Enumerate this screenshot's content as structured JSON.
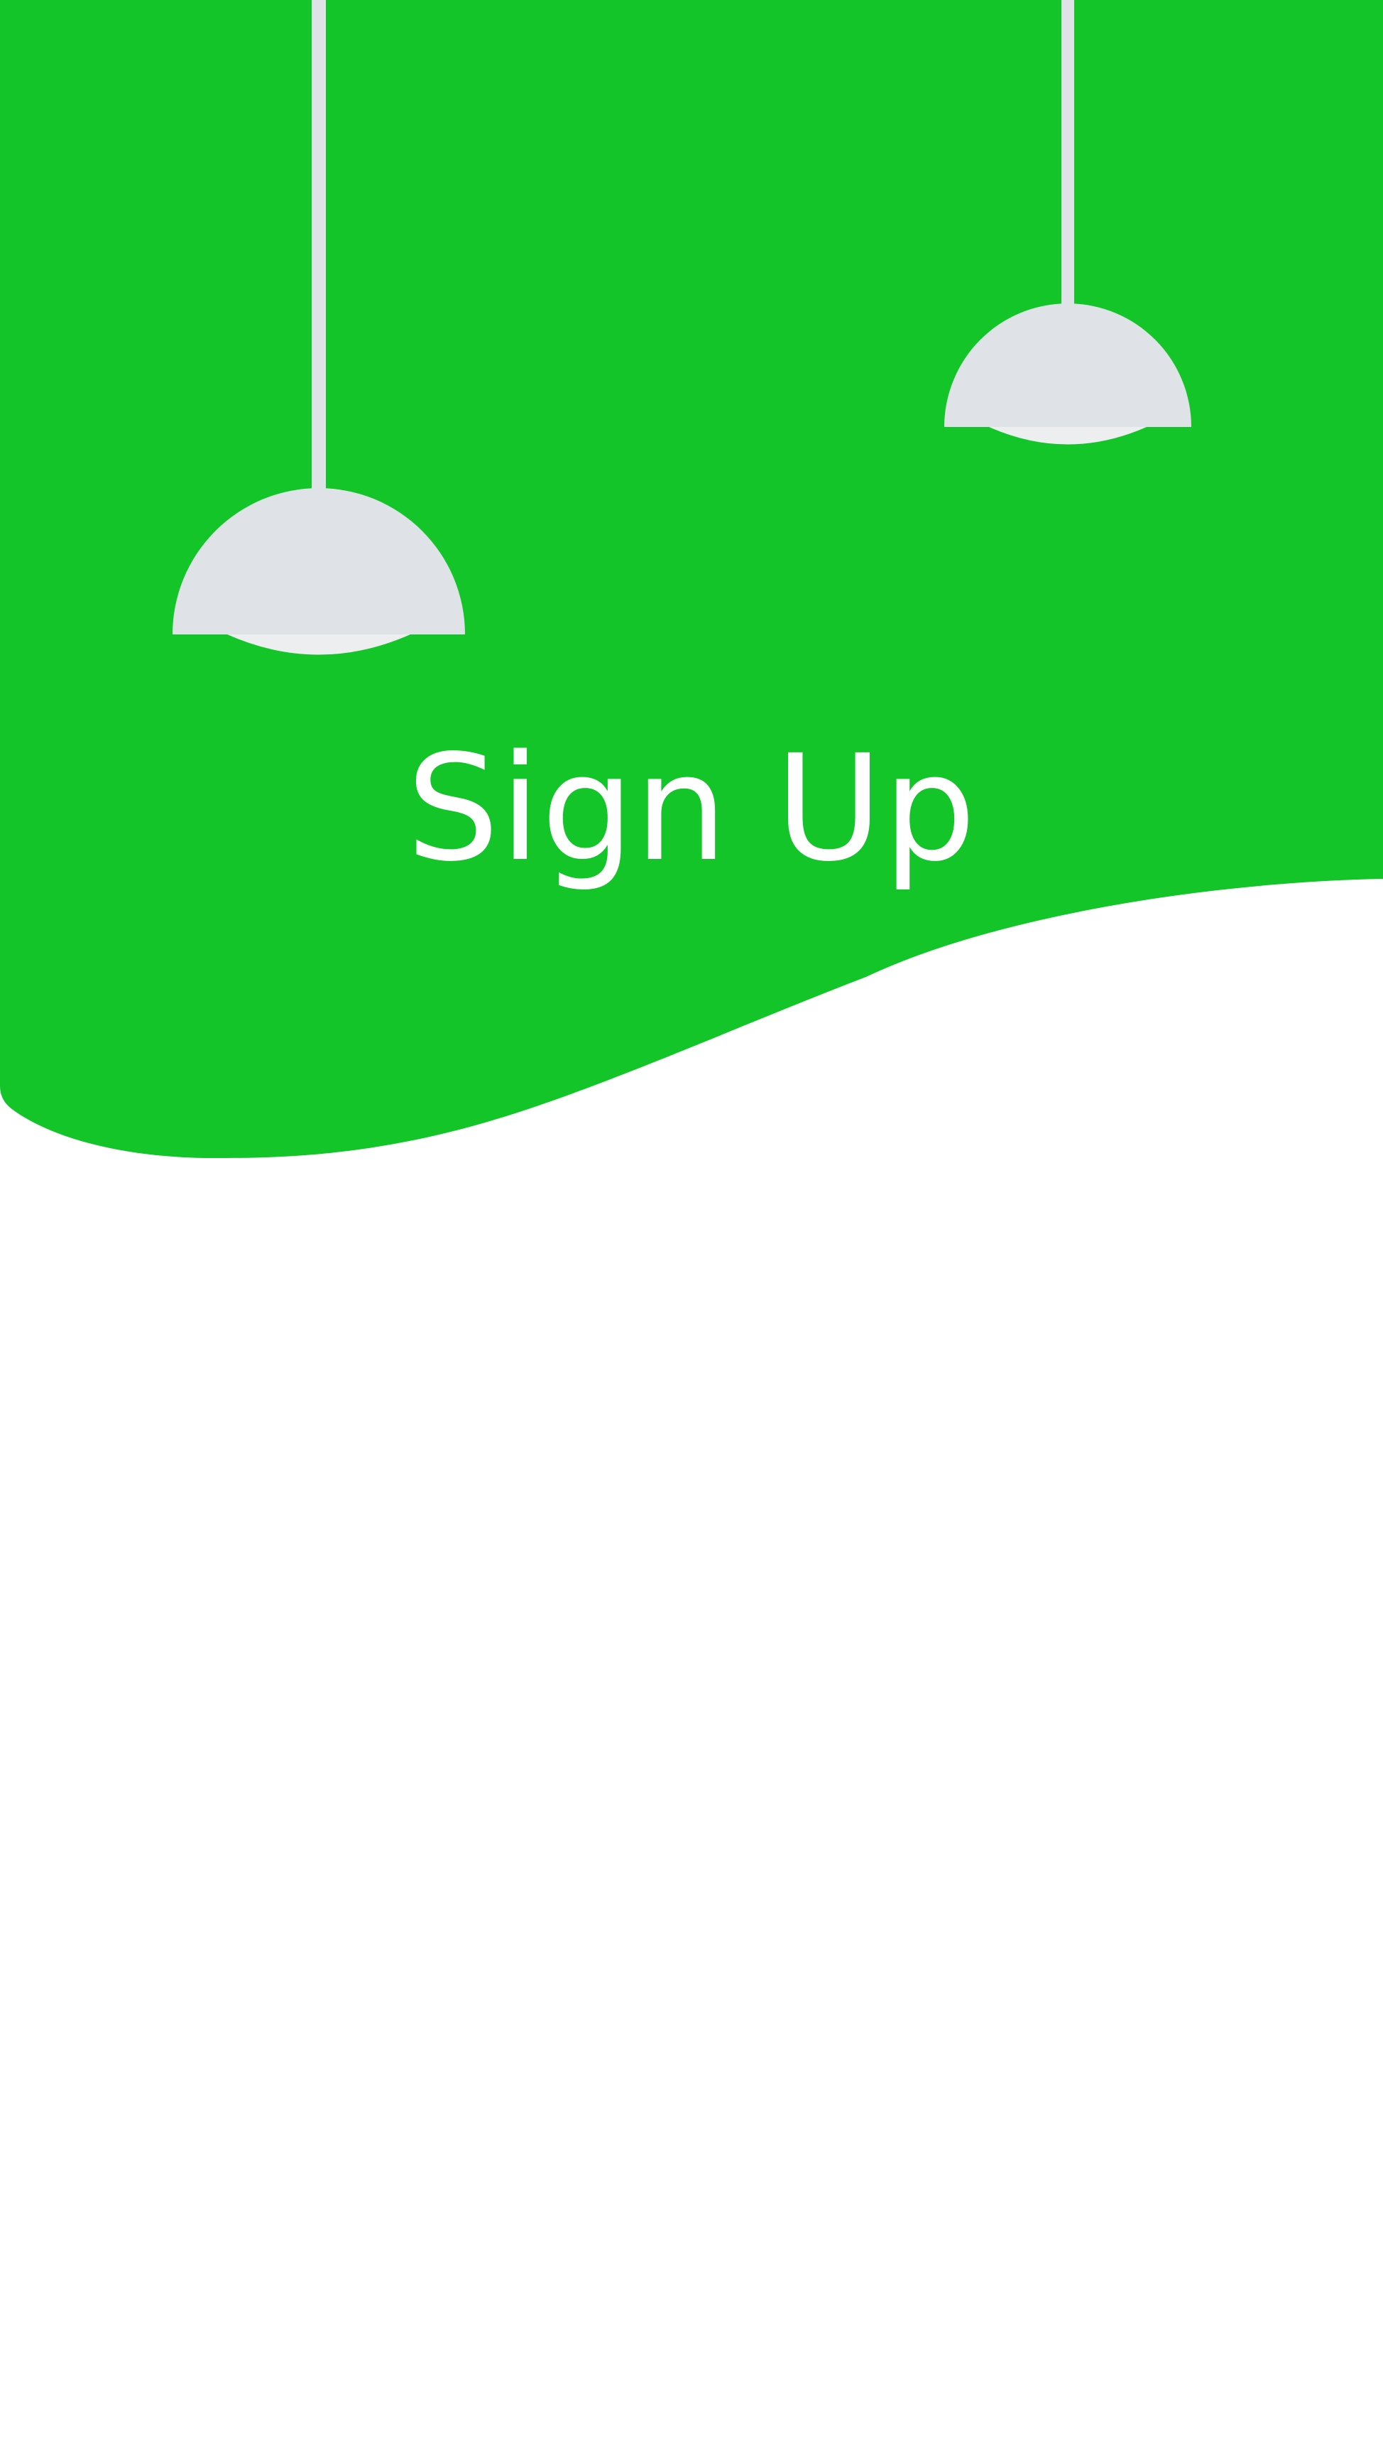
{
  "screen": {
    "title": "Sign Up"
  },
  "colors": {
    "header_green": "#13C528",
    "lamp_gray": "#DFE3E7",
    "lamp_rim": "#ECEEF0",
    "background": "#FFFFFF",
    "title_text": "#FFFFFF"
  },
  "icons": {
    "left_lamp": "pendant-lamp-icon",
    "right_lamp": "pendant-lamp-icon"
  }
}
